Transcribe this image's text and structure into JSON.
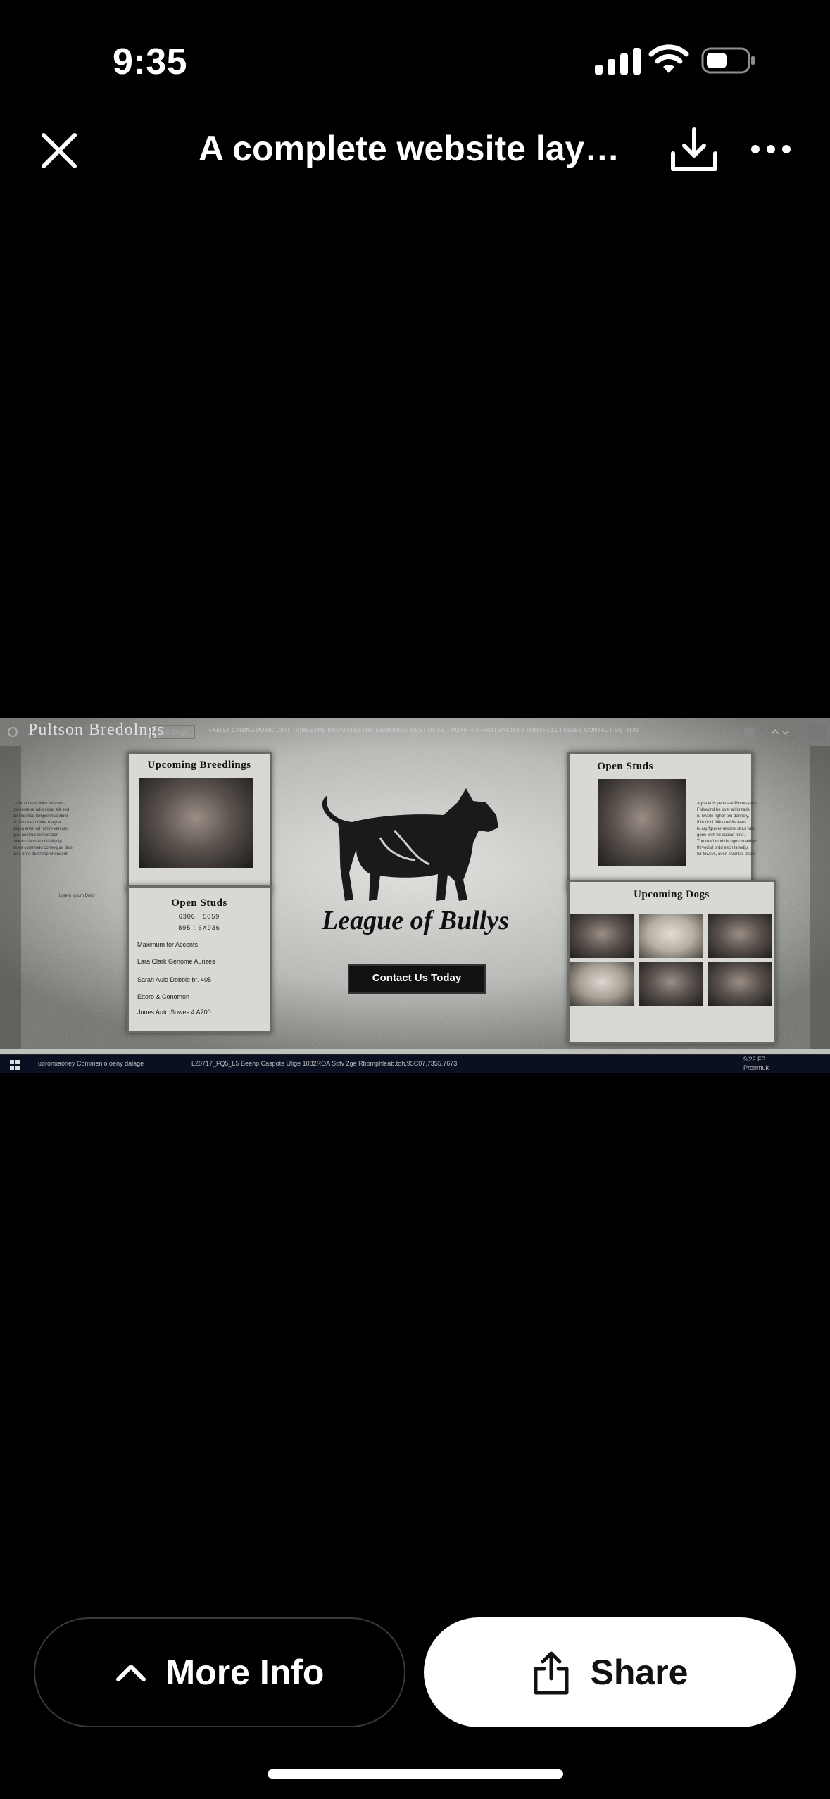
{
  "status_bar": {
    "time": "9:35"
  },
  "header": {
    "title": "A complete website layo..."
  },
  "website": {
    "brand": "Pultson Bredolngs",
    "search_label": "Find Dogs",
    "nav": [
      "FAMILY CARING",
      "PUBIC CHIT TRIBES",
      "THE PROMOTES",
      "THE MEMORIES",
      "RESTRICTS",
      "PUPP HIS FROTS",
      "INDIANA TRUST",
      "CLUTTAGES",
      "CONTACT BUTTON"
    ],
    "left_text": [
      "Lorem ipsum dolor sit amet,",
      "consectetur adipiscing elit sed",
      "do eiusmod tempor incididunt",
      "ut labore et dolore magna",
      "aliqua enim ad minim veniam",
      "quis nostrud exercitation",
      "ullamco laboris nisi aliquip",
      "ex ea commodo consequat duis",
      "aute irure dolor reprehenderit"
    ],
    "left_signature": "Lorem Ipsum Dolor",
    "upcoming_breedings_title": "Upcoming Breedlings",
    "open_studs_left": {
      "title": "Open Studs",
      "numbers": [
        "6306 : 5059",
        "895 : 6X936"
      ],
      "lines": [
        "Maximum for Accents",
        "Lara Clark Genome Aurizes",
        "Sarah Aulo Dobble br. 405",
        "Ettoro & Conomon",
        "Junes Auto Sowes 4 A700"
      ]
    },
    "hero_script": "League of Bullys",
    "cta": "Contact Us Today",
    "open_studs_right_title": "Open Studs",
    "right_text": [
      "Agna euls pens are Pitmesy ery.",
      "Followind be over all breads",
      "ru fwarte ngher tou donnely.",
      "If hr dodi frilks red fts lean.",
      "fv ary fgraver resone stras wits",
      "gone wi h fid eaolas fona.",
      "The read mod de ugen maedryo",
      "thrvodsd ordd eech la lodju.",
      "fvr towsvs, aven levonlie, deats"
    ],
    "upcoming_dogs_title": "Upcoming Dogs",
    "taskbar_text": "uoronuaoney Commenlo oeny dalage",
    "taskbar_text2": "L20717_FQ5_L5 Beenp Caspote Ulige 1082ROA Sotv 2ge Rbomphleab.toh,95C07,7355.7673",
    "taskbar_time": "9/22 FB",
    "taskbar_time2": "Prenmuk"
  },
  "buttons": {
    "more_info": "More Info",
    "share": "Share"
  },
  "icons": [
    "close-icon",
    "download-icon",
    "more-icon",
    "chevron-up-icon",
    "share-icon"
  ]
}
